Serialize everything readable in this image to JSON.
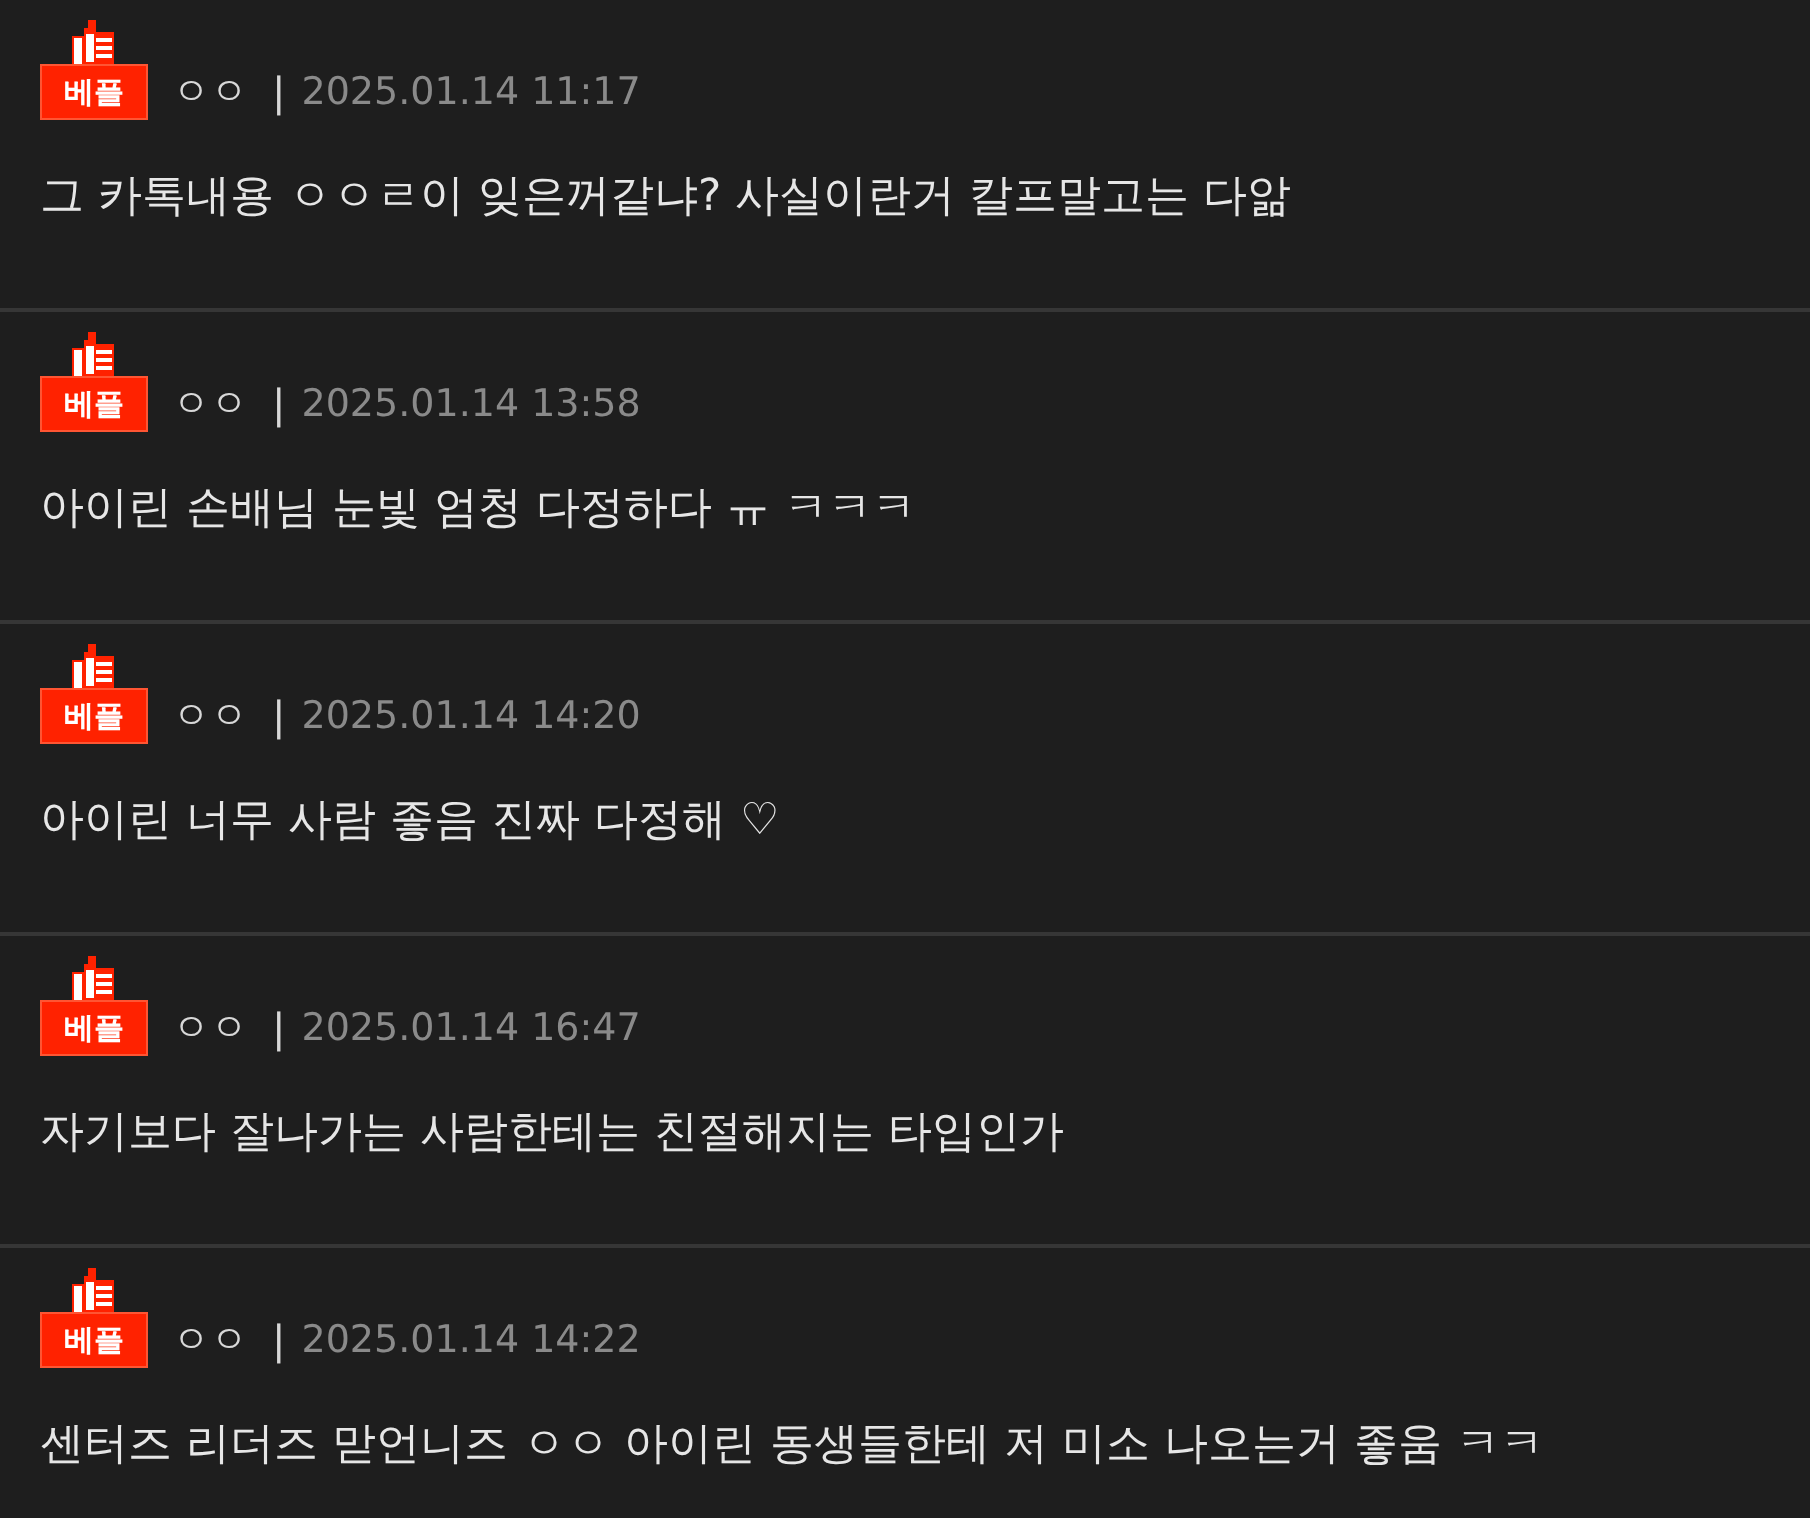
{
  "comments": [
    {
      "badge": "베플",
      "author": "ㅇㅇ",
      "separator": "|",
      "date": "2025.01.14 11:17",
      "text": "그 카톡내용 ㅇㅇㄹ이 잊은꺼같냐? 사실이란거 칼프말고는 다앎"
    },
    {
      "badge": "베플",
      "author": "ㅇㅇ",
      "separator": "|",
      "date": "2025.01.14 13:58",
      "text": "아이린 손배님 눈빛 엄청 다정하다 ㅠ ㅋㅋㅋ"
    },
    {
      "badge": "베플",
      "author": "ㅇㅇ",
      "separator": "|",
      "date": "2025.01.14 14:20",
      "text": "아이린 너무 사람 좋음 진짜 다정해 ♡"
    },
    {
      "badge": "베플",
      "author": "ㅇㅇ",
      "separator": "|",
      "date": "2025.01.14 16:47",
      "text": "자기보다 잘나가는 사람한테는 친절해지는 타입인가"
    },
    {
      "badge": "베플",
      "author": "ㅇㅇ",
      "separator": "|",
      "date": "2025.01.14 14:22",
      "text": "센터즈 리더즈 맏언니즈 ㅇㅇ 아이린 동생들한테 저 미소 나오는거 좋움 ㅋㅋ"
    }
  ]
}
